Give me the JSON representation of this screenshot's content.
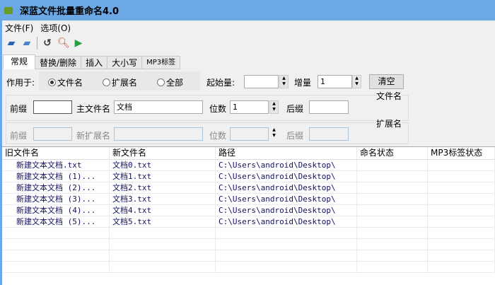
{
  "title": "深蓝文件批量重命名4.0",
  "menu": [
    "文件(F)",
    "选项(O)"
  ],
  "tabs": [
    "常规",
    "替换/删除",
    "插入",
    "大小写",
    "MP3标签"
  ],
  "apply": {
    "label": "作用于:",
    "options": [
      "文件名",
      "扩展名",
      "全部"
    ],
    "selected": "文件名"
  },
  "start": {
    "label": "起始量:",
    "value": ""
  },
  "step": {
    "label": "增量",
    "value": "1"
  },
  "clear": "清空",
  "fname": {
    "group": "文件名",
    "prefix_label": "前缀",
    "prefix": "",
    "main_label": "主文件名",
    "main": "文档",
    "digits_label": "位数",
    "digits": "1",
    "suffix_label": "后缀",
    "suffix": ""
  },
  "ext": {
    "group": "扩展名",
    "prefix_label": "前缀",
    "prefix": "",
    "main_label": "新扩展名",
    "main": "",
    "digits_label": "位数",
    "digits": "",
    "suffix_label": "后缀",
    "suffix": ""
  },
  "columns": [
    "旧文件名",
    "新文件名",
    "路径",
    "命名状态",
    "MP3标签状态"
  ],
  "rows": [
    [
      "新建文本文档.txt",
      "文档0.txt",
      "C:\\Users\\android\\Desktop\\",
      "",
      ""
    ],
    [
      "新建文本文档 (1)...",
      "文档1.txt",
      "C:\\Users\\android\\Desktop\\",
      "",
      ""
    ],
    [
      "新建文本文档 (2)...",
      "文档2.txt",
      "C:\\Users\\android\\Desktop\\",
      "",
      ""
    ],
    [
      "新建文本文档 (3)...",
      "文档3.txt",
      "C:\\Users\\android\\Desktop\\",
      "",
      ""
    ],
    [
      "新建文本文档 (4)...",
      "文档4.txt",
      "C:\\Users\\android\\Desktop\\",
      "",
      ""
    ],
    [
      "新建文本文档 (5)...",
      "文档5.txt",
      "C:\\Users\\android\\Desktop\\",
      "",
      ""
    ]
  ]
}
